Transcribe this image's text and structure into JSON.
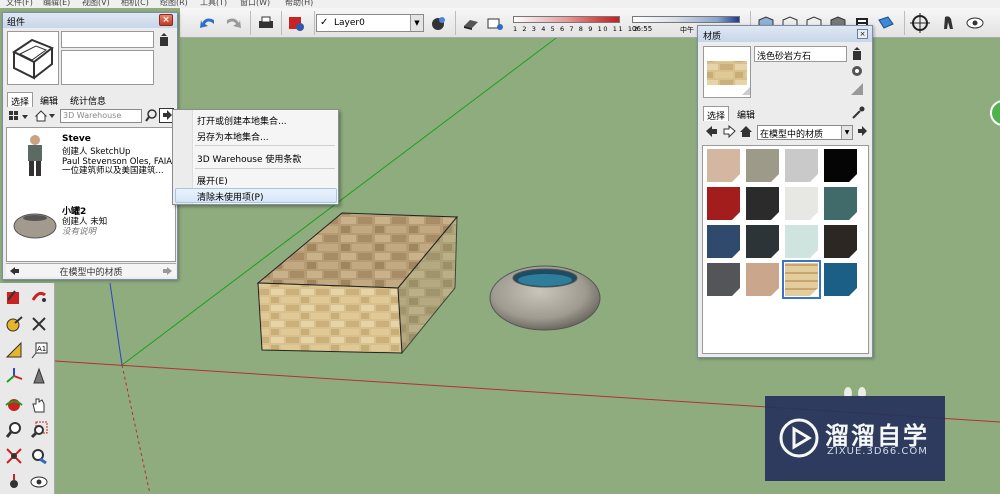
{
  "menubar": [
    "文件(F)",
    "编辑(E)",
    "视图(V)",
    "相机(C)",
    "绘图(R)",
    "工具(T)",
    "窗口(W)",
    "帮助(H)"
  ],
  "toolbar": {
    "layer": {
      "checked": true,
      "name": "Layer0"
    },
    "month_ticks": "1 2 3 4 5 6 7 8 9 10 11 12",
    "time_start": "06:55",
    "time_mid": "中午"
  },
  "components": {
    "title": "组件",
    "close": "×",
    "tabs": [
      "选择",
      "编辑",
      "统计信息"
    ],
    "search_placeholder": "3D Warehouse",
    "items": [
      {
        "name": "Steve",
        "line1": "创建人 SketchUp",
        "line2": "Paul Stevenson Oles, FAIA 是",
        "line3": "一位建筑师以及美国建筑..."
      },
      {
        "name": "小罐2",
        "line1": "创建人 未知",
        "line2": "没有说明"
      }
    ],
    "footer": "在模型中的材质"
  },
  "context_menu": {
    "items": [
      "打开或创建本地集合...",
      "另存为本地集合...",
      "3D Warehouse 使用条款",
      "展开(E)",
      "清除未使用项(P)"
    ],
    "highlighted_index": 4
  },
  "materials": {
    "title": "材质",
    "close": "×",
    "current_name": "浅色砂岩方石",
    "tabs": [
      "选择",
      "编辑"
    ],
    "collection": "在模型中的材质",
    "swatches": [
      {
        "color": "#d3b7a0",
        "selected": false
      },
      {
        "color": "#9d9a8a",
        "selected": false
      },
      {
        "color": "#c9c9c9",
        "selected": false
      },
      {
        "color": "#050505",
        "selected": false
      },
      {
        "color": "#a41d1d",
        "selected": false
      },
      {
        "color": "#2b2b2b",
        "selected": false
      },
      {
        "color": "#e7e7e3",
        "selected": false
      },
      {
        "color": "#416b6b",
        "selected": false
      },
      {
        "color": "#2f4a6d",
        "selected": false
      },
      {
        "color": "#2d3438",
        "selected": false
      },
      {
        "color": "#cfe3df",
        "selected": false
      },
      {
        "color": "#2c2723",
        "selected": false
      },
      {
        "color": "#545558",
        "selected": false
      },
      {
        "color": "#caa68c",
        "selected": false
      },
      {
        "color": "#d8bf8b",
        "selected": true
      },
      {
        "color": "#1b5e86",
        "selected": false
      }
    ]
  },
  "watermark": {
    "cn": "溜溜自学",
    "en": "ZIXUE.3D66.COM"
  },
  "colors": {
    "viewport_bg": "#8fac7f",
    "panel_bg": "#ececec",
    "title_bar": "#c7d6ea",
    "highlight": "#d6e6f8",
    "watermark_bg": "#26325c"
  }
}
